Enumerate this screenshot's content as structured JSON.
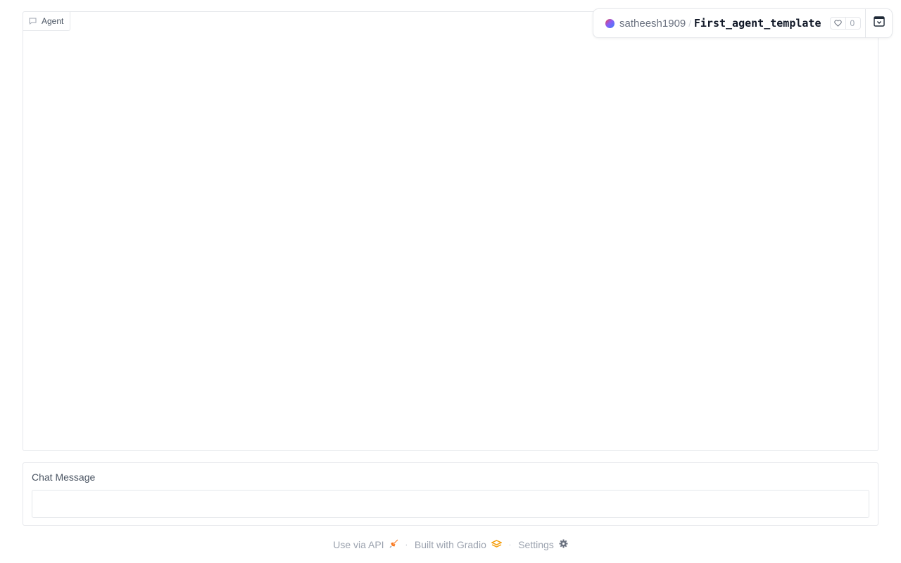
{
  "chatbot": {
    "label": "Agent",
    "label_icon": "chat-icon"
  },
  "space_badge": {
    "owner": "satheesh1909",
    "separator": "/",
    "space_name": "First_agent_template",
    "likes": "0",
    "like_icon": "heart-icon",
    "collapse_icon": "collapse-icon"
  },
  "input": {
    "label": "Chat Message",
    "value": "",
    "placeholder": ""
  },
  "footer": {
    "api_label": "Use via API",
    "api_icon": "rocket-icon",
    "gradio_label": "Built with Gradio",
    "gradio_icon": "gradio-logo-icon",
    "settings_label": "Settings",
    "settings_icon": "gear-icon",
    "separator": "·"
  },
  "colors": {
    "border": "#e5e7eb",
    "footer_text": "#9ca3af",
    "gradio_orange": "#f59e0b"
  }
}
